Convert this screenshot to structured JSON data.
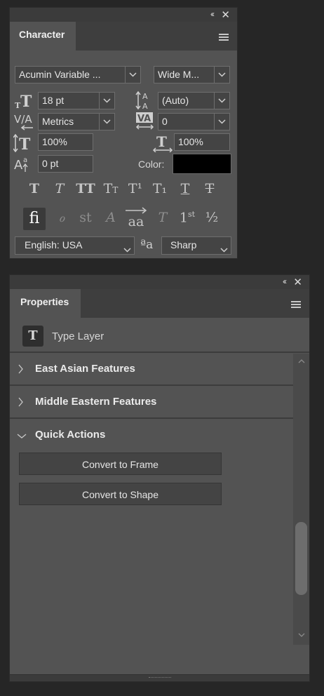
{
  "character": {
    "tab_label": "Character",
    "font_family": "Acumin Variable ...",
    "font_style": "Wide M...",
    "font_size": "18 pt",
    "leading": "(Auto)",
    "kerning": "Metrics",
    "tracking": "0",
    "vertical_scale": "100%",
    "horizontal_scale": "100%",
    "baseline_shift": "0 pt",
    "color_label": "Color:",
    "color_value": "#000000",
    "language": "English: USA",
    "antialias_glyph": "ªa",
    "antialias": "Sharp",
    "type_styles": [
      "T",
      "T",
      "TT",
      "TT",
      "T¹",
      "T₁",
      "T",
      "T"
    ],
    "opentype": [
      "ﬁ",
      "ℴ",
      "st",
      "𝒜",
      "aa",
      "T",
      "1st",
      "½"
    ]
  },
  "properties": {
    "tab_label": "Properties",
    "layer_type": "Type Layer",
    "layer_icon_glyph": "T",
    "sections": [
      {
        "title": "East Asian Features"
      },
      {
        "title": "Middle Eastern Features"
      },
      {
        "title": "Quick Actions"
      }
    ],
    "buttons": [
      "Convert to Frame",
      "Convert to Shape"
    ]
  }
}
